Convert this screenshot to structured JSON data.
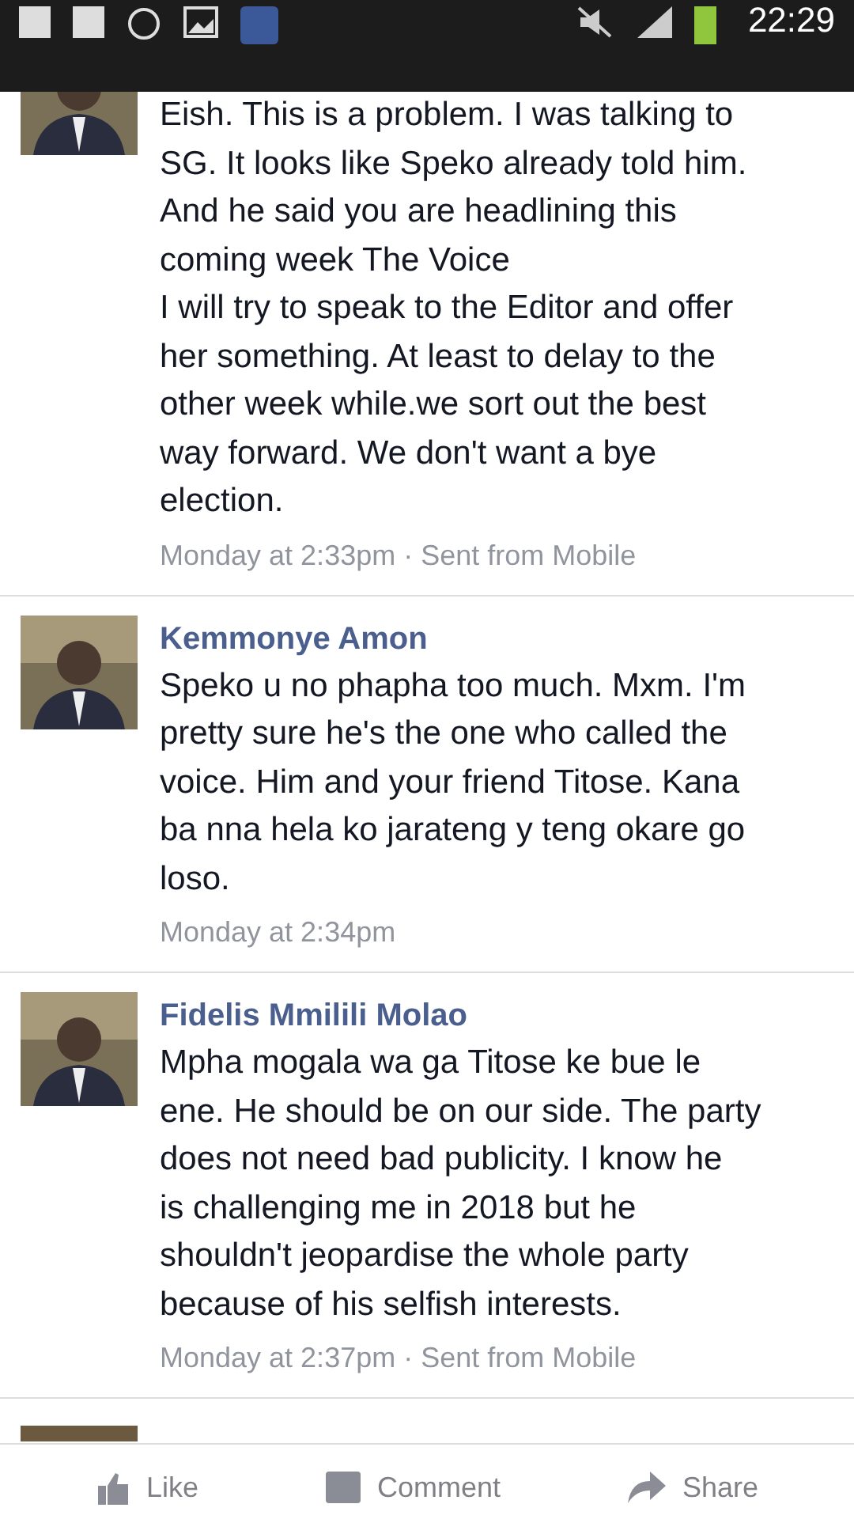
{
  "status_bar": {
    "time": "22:29"
  },
  "messages": [
    {
      "cropped": true,
      "lines": [
        "Eish. This is a problem. I was talking to",
        "SG. It looks like Speko already told him.",
        "And he said you are headlining this",
        "coming week The Voice",
        "I will try to speak to the Editor and offer",
        "her something. At least to delay to the",
        "other week while.we sort out the best",
        "way forward. We don't want a bye",
        "election."
      ],
      "meta": "Monday at 2:33pm · Sent from Mobile"
    },
    {
      "author": "Kemmonye Amon",
      "cropped": false,
      "lines": [
        "Speko u no phapha too much. Mxm. I'm",
        "pretty sure he's the one who called the",
        "voice. Him and your friend Titose. Kana",
        "ba nna hela ko jarateng y teng okare go",
        "loso."
      ],
      "meta": "Monday at 2:34pm"
    },
    {
      "author": "Fidelis Mmilili Molao",
      "cropped": false,
      "lines": [
        "Mpha mogala wa ga Titose ke bue le",
        "ene. He should be on our side. The party",
        "does not need bad publicity. I know he",
        "is challenging me in 2018 but he",
        "shouldn't jeopardise the whole party",
        "because of his selfish interests."
      ],
      "meta": "Monday at 2:37pm · Sent from Mobile"
    }
  ],
  "actions": [
    "Like",
    "Comment",
    "Share"
  ]
}
